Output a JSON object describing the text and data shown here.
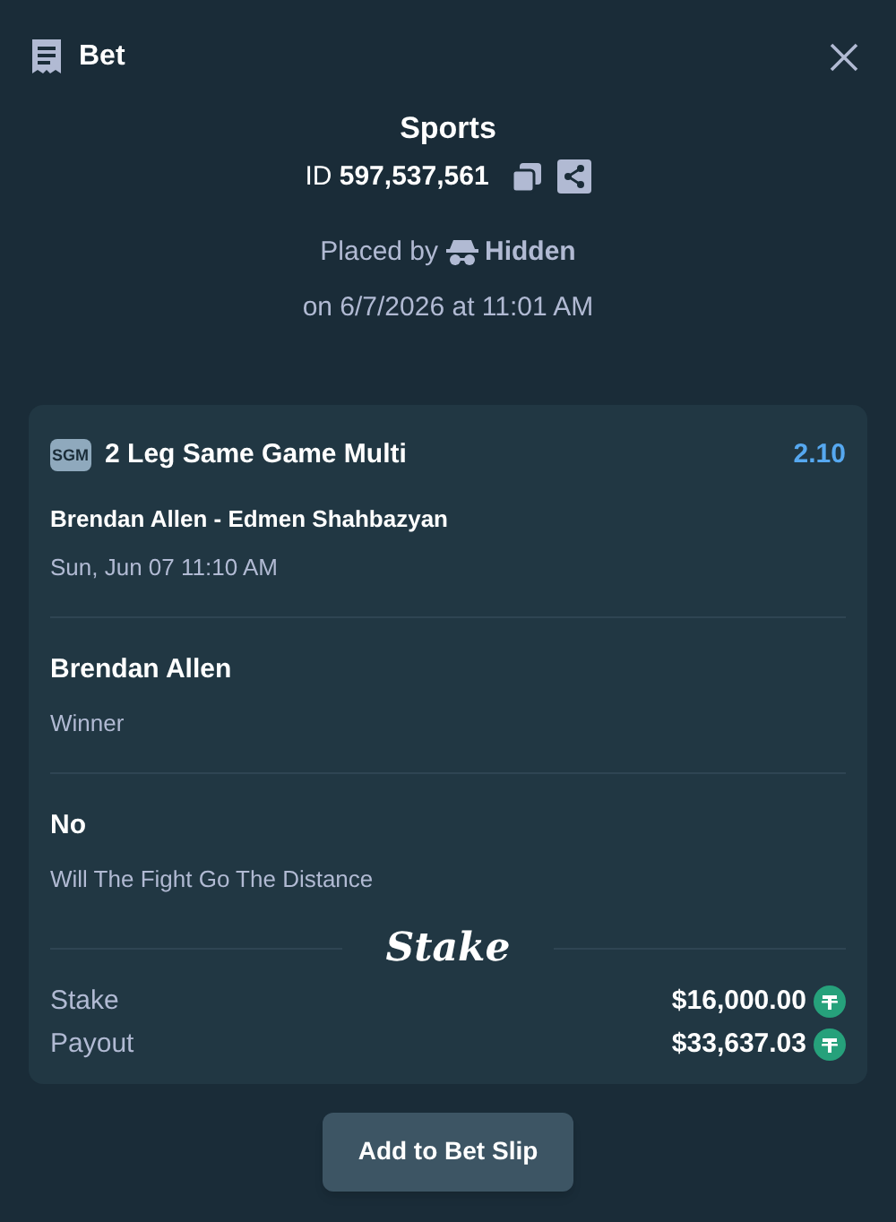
{
  "header": {
    "title": "Bet"
  },
  "summary": {
    "category": "Sports",
    "id_label": "ID",
    "id_value": "597,537,561",
    "placed_by": "Placed by",
    "user": "Hidden",
    "placed_on": "on 6/7/2026 at 11:01 AM"
  },
  "bet": {
    "badge": "SGM",
    "title": "2 Leg Same Game Multi",
    "odds": "2.10",
    "event": "Brendan Allen - Edmen Shahbazyan",
    "event_time": "Sun, Jun 07 11:10 AM",
    "legs": [
      {
        "selection": "Brendan Allen",
        "market": "Winner"
      },
      {
        "selection": "No",
        "market": "Will The Fight Go The Distance"
      }
    ],
    "logo": "Stake",
    "amounts": [
      {
        "label": "Stake",
        "value": "$16,000.00"
      },
      {
        "label": "Payout",
        "value": "$33,637.03"
      }
    ]
  },
  "action": "Add to Bet Slip"
}
